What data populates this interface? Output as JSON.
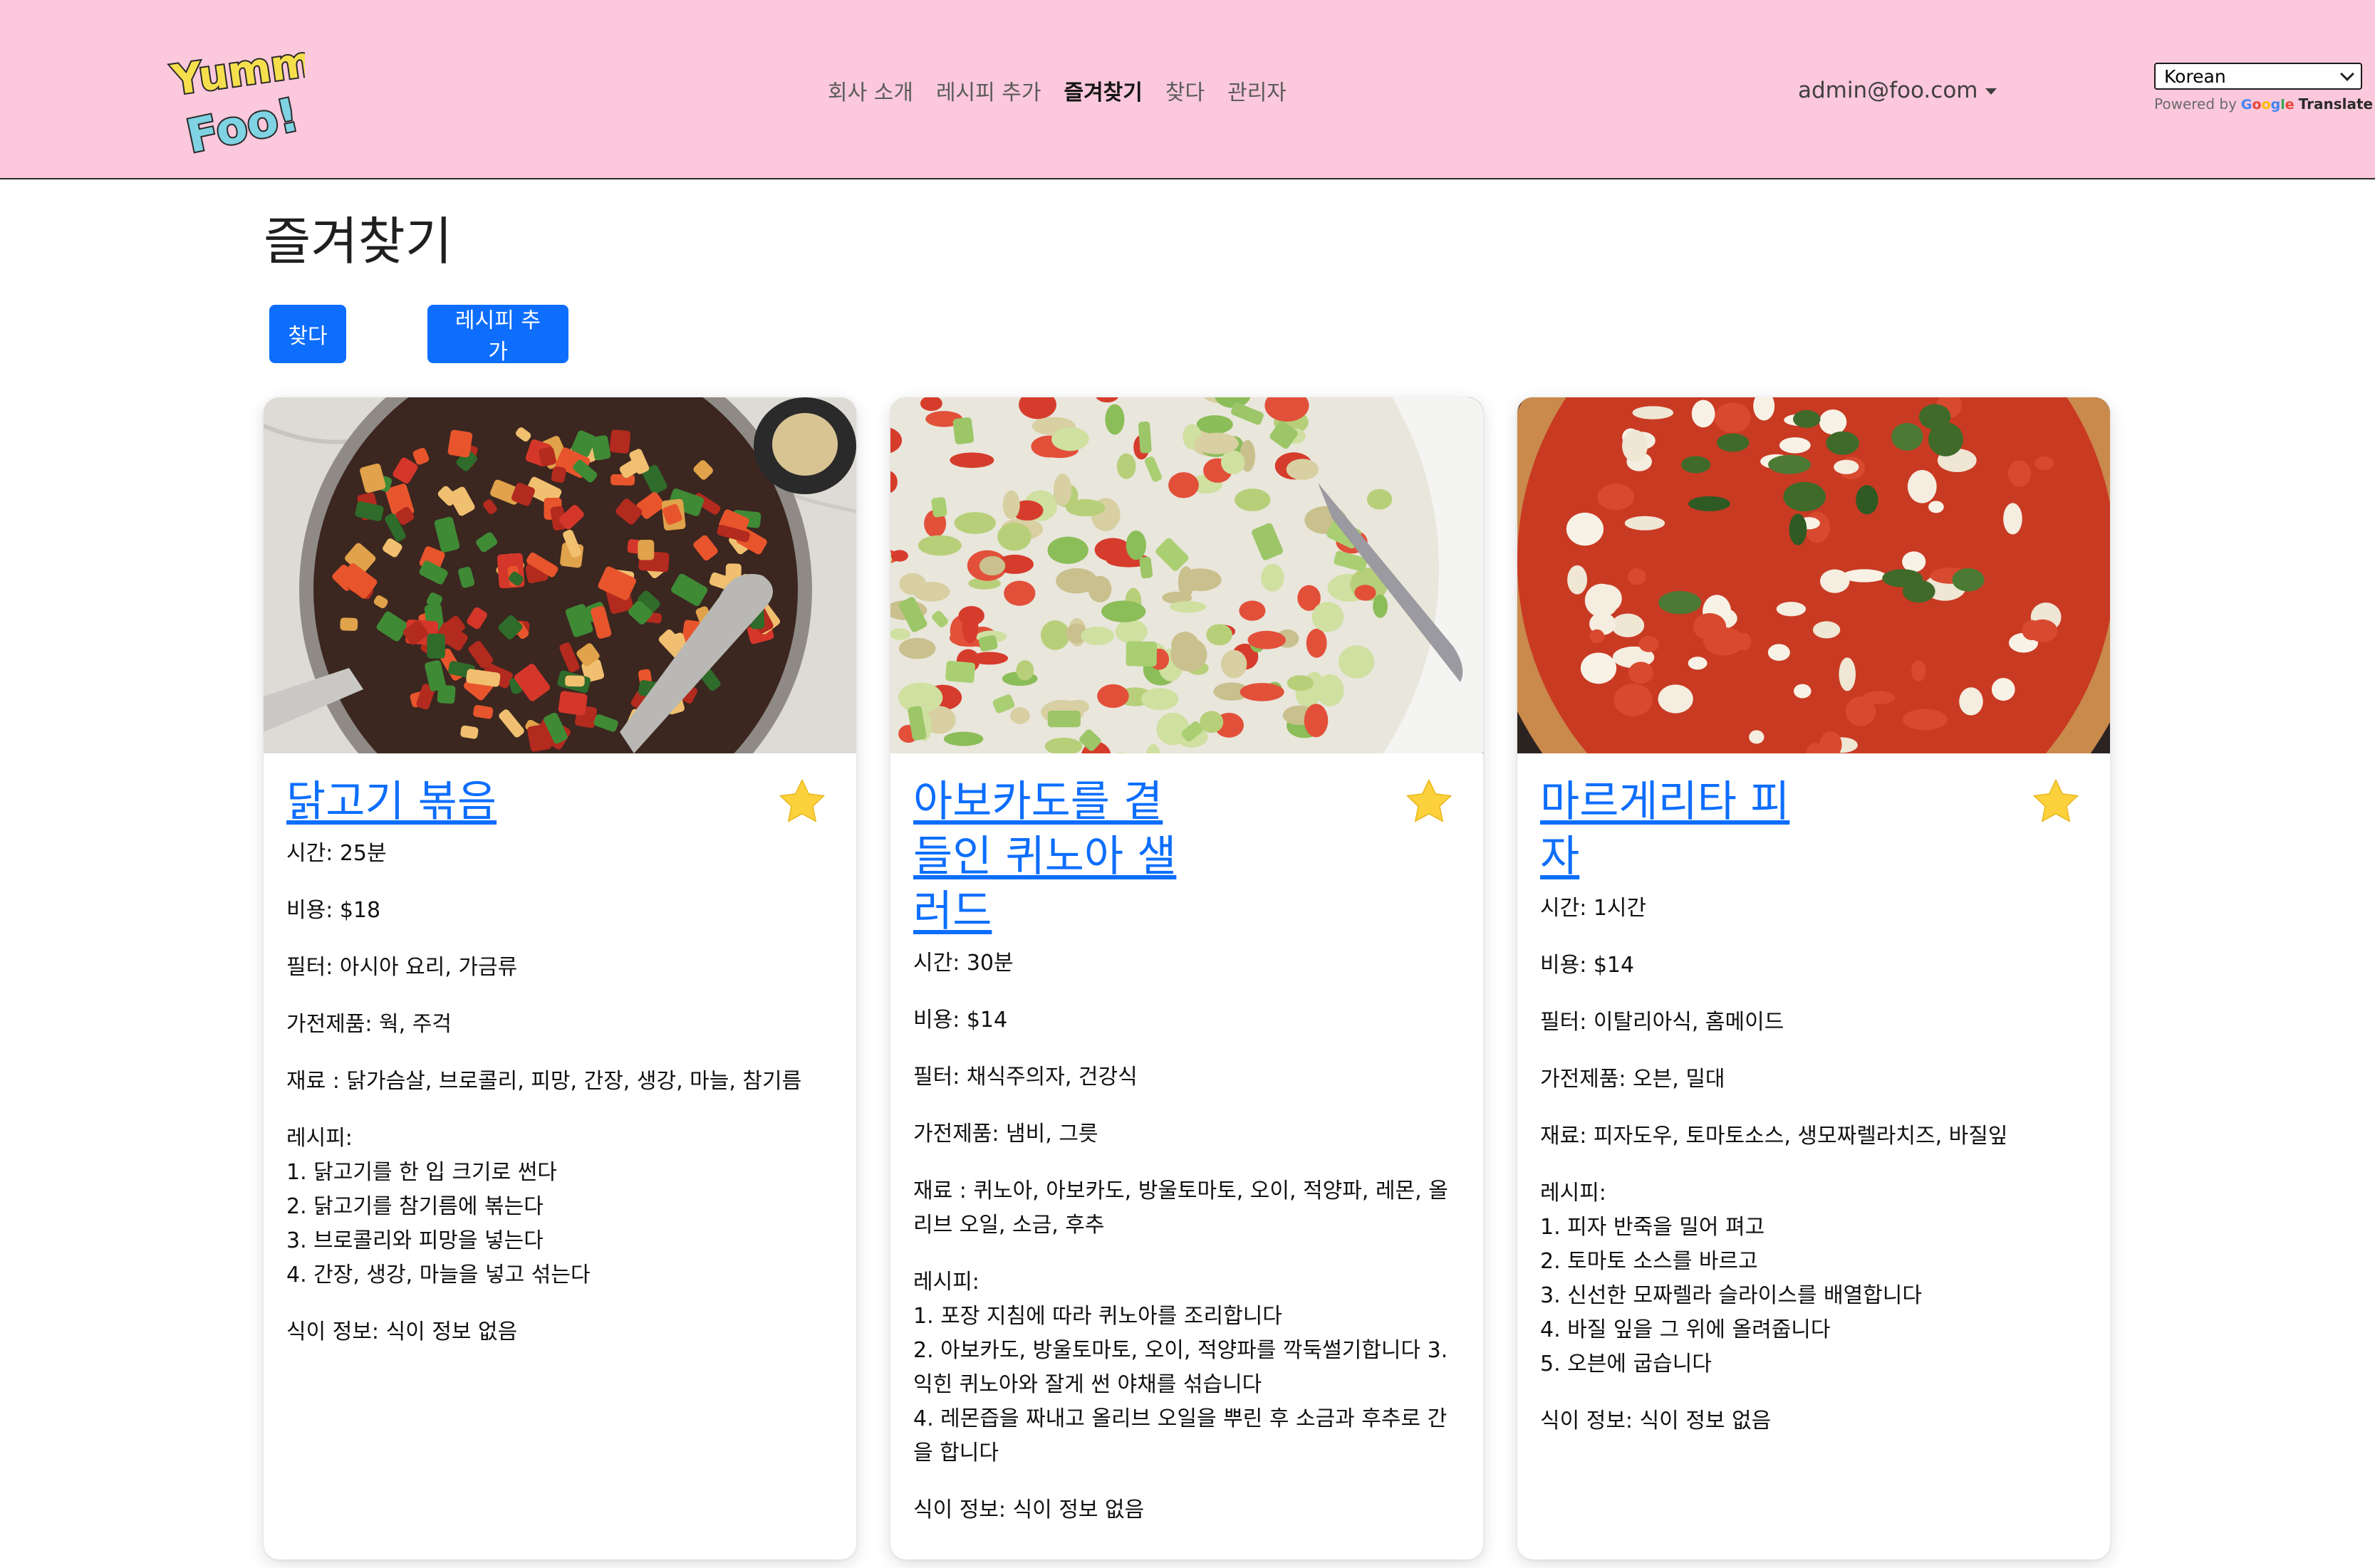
{
  "navbar": {
    "logo": {
      "line1": "Yummy",
      "line2": "Foo!"
    },
    "links": [
      {
        "label": "회사 소개",
        "active": false
      },
      {
        "label": "레시피 추가",
        "active": false
      },
      {
        "label": "즐겨찾기",
        "active": true
      },
      {
        "label": "찾다",
        "active": false
      },
      {
        "label": "관리자",
        "active": false
      }
    ],
    "user_email": "admin@foo.com",
    "translate": {
      "selected_language": "Korean",
      "powered_by": "Powered by",
      "google_letters": [
        "G",
        "o",
        "o",
        "g",
        "l",
        "e"
      ],
      "google_colors": [
        "#4285F4",
        "#EA4335",
        "#FBBC05",
        "#4285F4",
        "#34A853",
        "#EA4335"
      ],
      "translate_word": "Translate"
    },
    "background_color": "#fbc8dc"
  },
  "page": {
    "title": "즐겨찾기",
    "search_button": "찾다",
    "add_recipe_button": "레시피 추가"
  },
  "accent_color": "#0d6efd",
  "star_color": "#fcd13b",
  "recipes": [
    {
      "title": "닭고기 볶음",
      "image": "chicken-stir-fry-pan",
      "favorited": true,
      "time": "시간: 25분",
      "cost": "비용: $18",
      "filter": "필터: 아시아 요리, 가금류",
      "appliances": "가전제품: 웍, 주걱",
      "ingredients": "재료 : 닭가슴살, 브로콜리, 피망, 간장, 생강, 마늘, 참기름",
      "recipe_label": "레시피:",
      "steps": [
        "1. 닭고기를 한 입 크기로 썬다",
        "2. 닭고기를 참기름에 볶는다",
        "3. 브로콜리와 피망을 넣는다",
        "4. 간장, 생강, 마늘을 넣고 섞는다"
      ],
      "diet": "식이 정보: 식이 정보 없음"
    },
    {
      "title": "아보카도를 곁들인 퀴노아 샐러드",
      "image": "quinoa-avocado-salad-bowl",
      "favorited": true,
      "time": "시간: 30분",
      "cost": "비용: $14",
      "filter": "필터: 채식주의자, 건강식",
      "appliances": "가전제품: 냄비, 그릇",
      "ingredients": "재료 : 퀴노아, 아보카도, 방울토마토, 오이, 적양파, 레몬, 올리브 오일, 소금, 후추",
      "recipe_label": "레시피:",
      "steps": [
        "1. 포장 지침에 따라 퀴노아를 조리합니다",
        "2. 아보카도, 방울토마토, 오이, 적양파를 깍둑썰기합니다 3. 익힌 퀴노아와 잘게 썬 야채를 섞습니다",
        "4. 레몬즙을 짜내고 올리브 오일을 뿌린 후 소금과 후추로 간을 합니다"
      ],
      "diet": "식이 정보: 식이 정보 없음"
    },
    {
      "title": "마르게리타 피자",
      "image": "margherita-pizza",
      "favorited": true,
      "time": "시간: 1시간",
      "cost": "비용: $14",
      "filter": "필터: 이탈리아식, 홈메이드",
      "appliances": "가전제품: 오븐, 밀대",
      "ingredients": "재료: 피자도우, 토마토소스, 생모짜렐라치즈, 바질잎",
      "recipe_label": "레시피:",
      "steps": [
        "1. 피자 반죽을 밀어 펴고",
        "2. 토마토 소스를 바르고",
        "3. 신선한 모짜렐라 슬라이스를 배열합니다",
        "4. 바질 잎을 그 위에 올려줍니다",
        "5. 오븐에 굽습니다"
      ],
      "diet": "식이 정보: 식이 정보 없음"
    }
  ]
}
